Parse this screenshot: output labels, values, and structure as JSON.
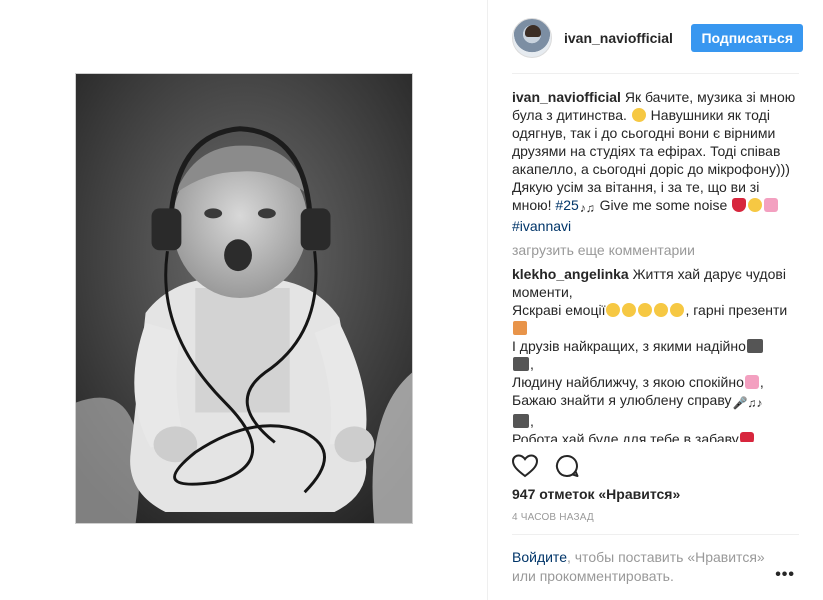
{
  "post": {
    "username": "ivan_naviofficial",
    "follow_label": "Подписаться"
  },
  "caption": {
    "username": "ivan_naviofficial",
    "text_1": "Як бачите, музика зі мною була з дитинства. ",
    "text_2": " Навушники як тоді одягнув, так і до сьогодні вони є вірними друзями на студіях та ефірах. Тоді співав акапелло, а сьогодні доріс до мікрофону))) Дякую усім за вітання, і за те, що ви зі мною! ",
    "hashtag_1": "#25",
    "text_3": " Give me some noise ",
    "hashtag_2": "#ivannavi"
  },
  "load_more_label": "загрузить еще комментарии",
  "comment": {
    "username": "klekho_angelinka",
    "line_1": "Життя хай дарує чудові моменти,",
    "line_2": "Яскраві емоції",
    "line_2b": ", гарні презенти",
    "line_3": "І друзів найкращих, з якими надійно",
    "line_4": "Людину найближчу, з якою спокійно",
    "line_5": "Бажаю знайти я улюблену справу",
    "line_6": "Робота хай буде для тебе в забаву"
  },
  "likes_label": "947 отметок «Нравится»",
  "time_label": "4 часов назад",
  "login": {
    "link": "Войдите",
    "text": ", чтобы поставить «Нравится» или прокомментировать."
  },
  "more_label": "•••",
  "icons": {
    "like": "heart-icon",
    "comment": "comment-icon",
    "more": "more-options-icon"
  }
}
